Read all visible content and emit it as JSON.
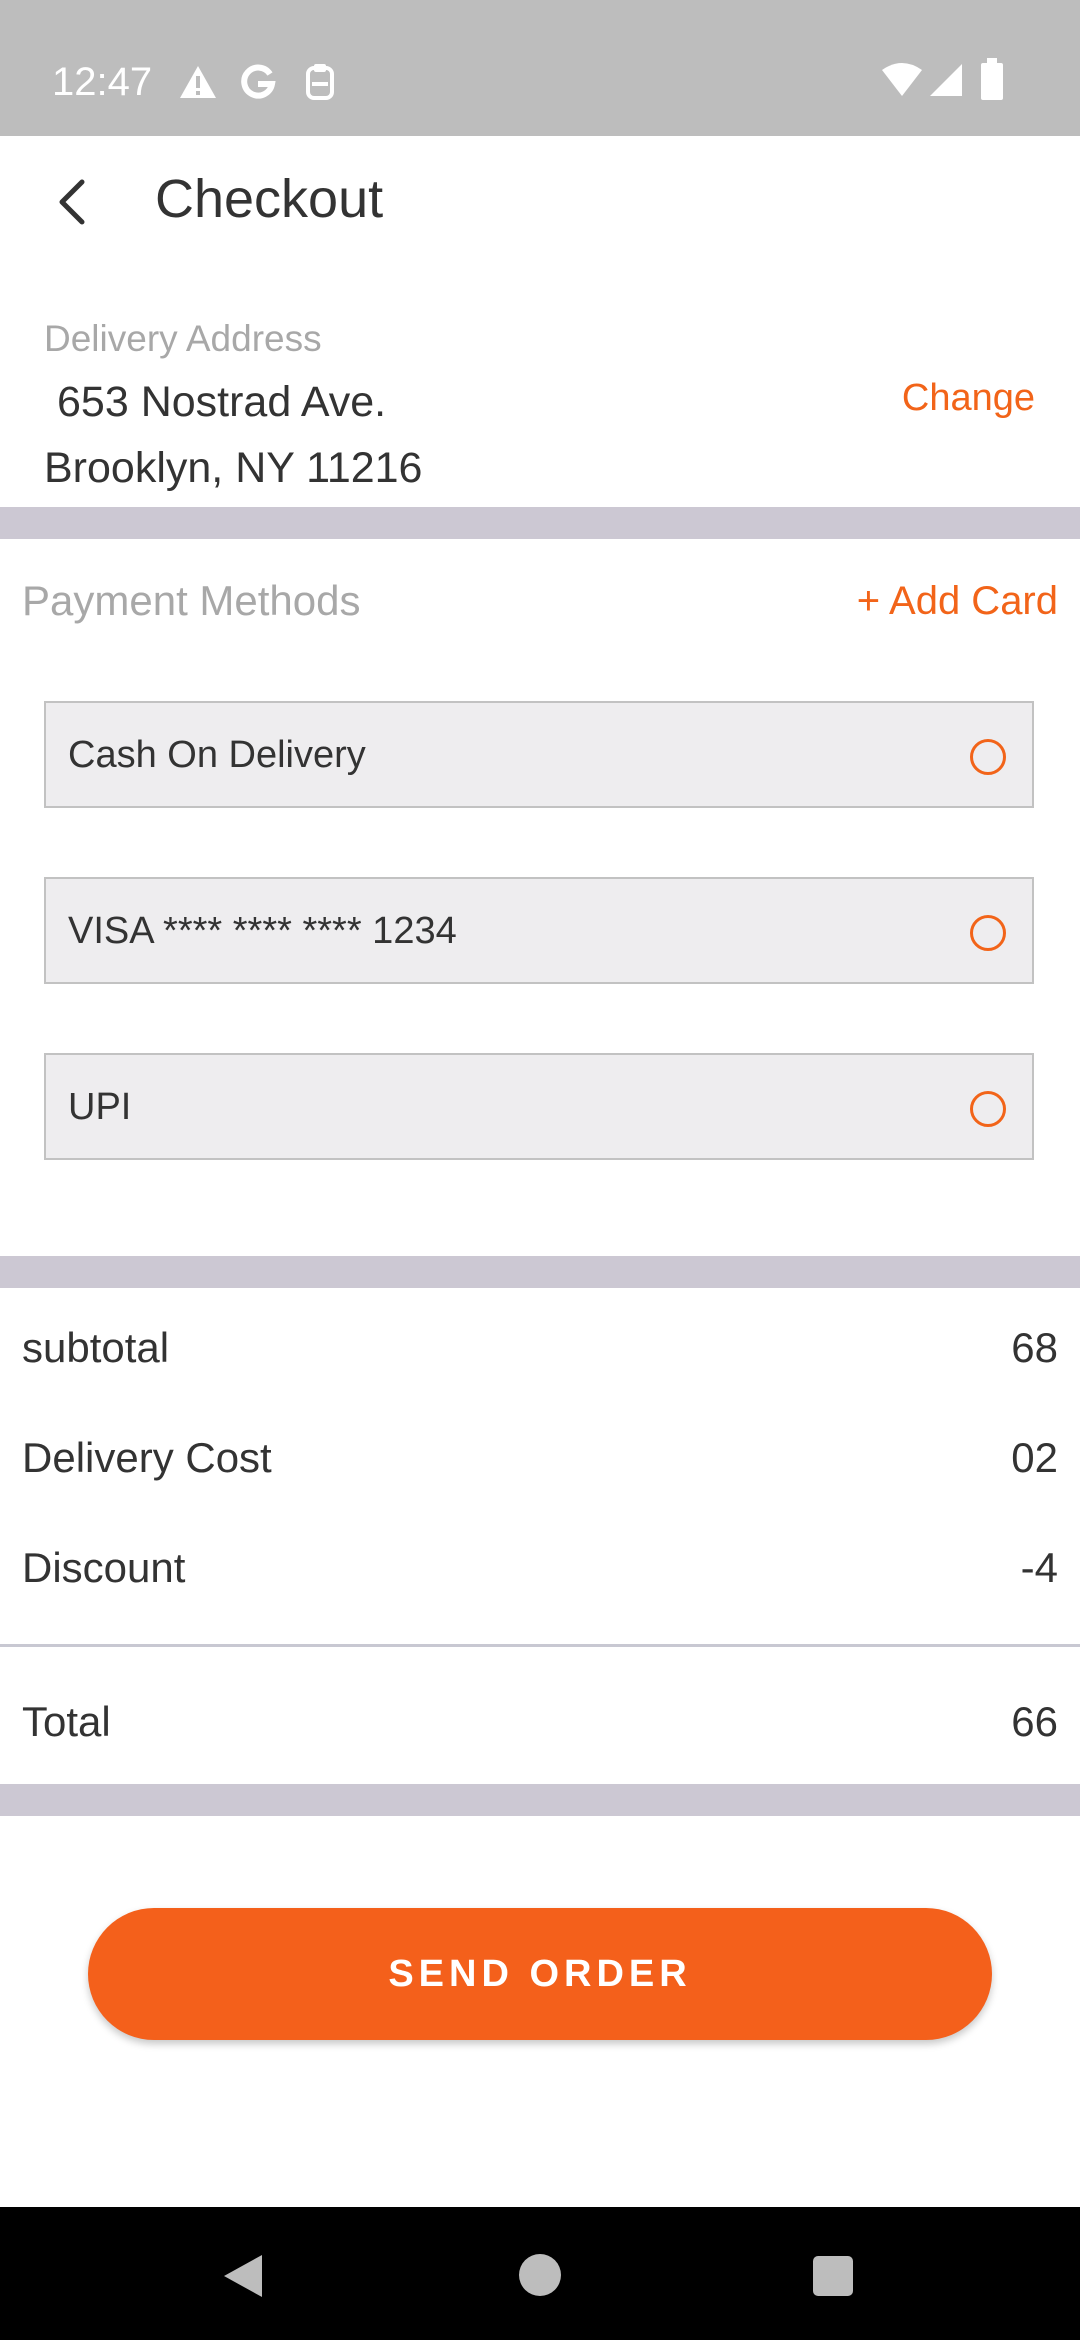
{
  "status_bar": {
    "time": "12:47",
    "icons": [
      "alert-icon",
      "google-icon",
      "clipboard-icon",
      "wifi-icon",
      "cellular-icon",
      "battery-icon"
    ]
  },
  "header": {
    "title": "Checkout",
    "back_icon": "chevron-left-icon"
  },
  "delivery": {
    "caption": "Delivery Address",
    "line1": "653 Nostrad Ave.",
    "line2": "Brooklyn, NY 11216",
    "change_label": "Change"
  },
  "payment": {
    "header": "Payment Methods",
    "add_card_label": "+ Add Card",
    "options": [
      {
        "label": "Cash On Delivery",
        "selected": false
      },
      {
        "label": "VISA **** **** **** 1234",
        "selected": false
      },
      {
        "label": "UPI",
        "selected": false
      }
    ]
  },
  "summary": {
    "rows": [
      {
        "label": "subtotal",
        "value": "68"
      },
      {
        "label": "Delivery Cost",
        "value": "02"
      },
      {
        "label": "Discount",
        "value": "-4"
      }
    ],
    "total": {
      "label": "Total",
      "value": "66"
    }
  },
  "action": {
    "send_label": "SEND ORDER"
  },
  "colors": {
    "accent": "#f26419",
    "divider": "#ccc8d3",
    "status_bar": "#bdbdbd"
  },
  "nav_bar": {
    "icons": [
      "back-triangle-icon",
      "home-circle-icon",
      "recents-square-icon"
    ]
  }
}
